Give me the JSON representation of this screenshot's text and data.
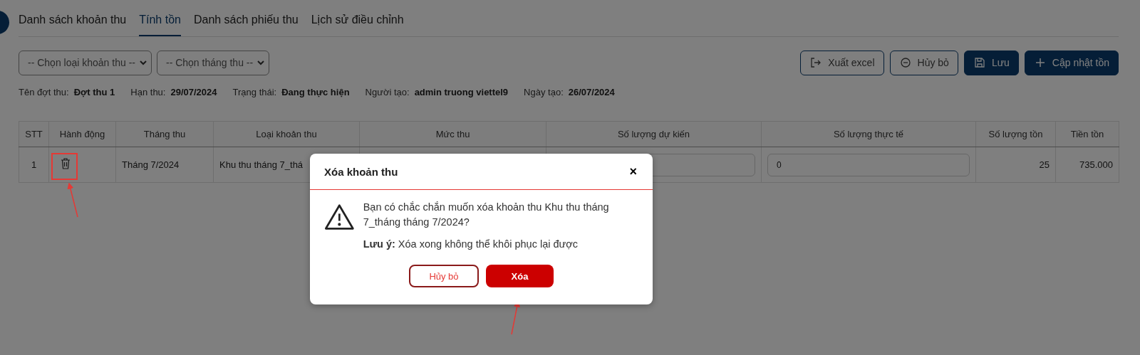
{
  "tabs": [
    {
      "label": "Danh sách khoản thu",
      "selected": false
    },
    {
      "label": "Tính tồn",
      "selected": true
    },
    {
      "label": "Danh sách phiếu thu",
      "selected": false
    },
    {
      "label": "Lịch sử điều chỉnh",
      "selected": false
    }
  ],
  "filters": [
    {
      "value": "-- Chọn loại khoản thu --"
    },
    {
      "value": "-- Chọn tháng thu --"
    }
  ],
  "actions": [
    {
      "label": "Xuất excel",
      "kind": "outline"
    },
    {
      "label": "Hủy bỏ",
      "kind": "outline"
    },
    {
      "label": "Lưu",
      "kind": "primary"
    },
    {
      "label": "Cập nhật tồn",
      "kind": "primary"
    }
  ],
  "info": [
    {
      "label": "Tên đợt thu:",
      "value": "Đợt thu 1"
    },
    {
      "label": "Hạn thu:",
      "value": "29/07/2024"
    },
    {
      "label": "Trạng thái:",
      "value": "Đang thực hiện"
    },
    {
      "label": "Người tạo:",
      "value": "admin truong viettel9"
    },
    {
      "label": "Ngày tạo:",
      "value": "26/07/2024"
    }
  ],
  "table": {
    "columns": [
      "STT",
      "Hành động",
      "Tháng thu",
      "Loại khoản thu",
      "Mức thu",
      "Số lượng dự kiến",
      "Số lượng thực tế",
      "Số lượng tồn",
      "Tiền tồn"
    ],
    "rows": [
      {
        "stt": "1",
        "month": "Tháng 7/2024",
        "fee_type": "Khu thu tháng 7_thá",
        "actual_quantity": "0",
        "remaining_quantity": "25",
        "remaining_amount": "735.000"
      }
    ]
  },
  "dialog": {
    "title": "Xóa khoản thu",
    "close": "×",
    "message": "Bạn có chắc chắn muốn xóa khoản thu Khu thu tháng 7_tháng tháng 7/2024?",
    "note": "**Lưu ý:** Xóa xong không thể khôi phục lại được",
    "buttons": [
      {
        "label": "Hủy bỏ",
        "kind": "cancel"
      },
      {
        "label": "Xóa",
        "kind": "danger"
      }
    ]
  }
}
